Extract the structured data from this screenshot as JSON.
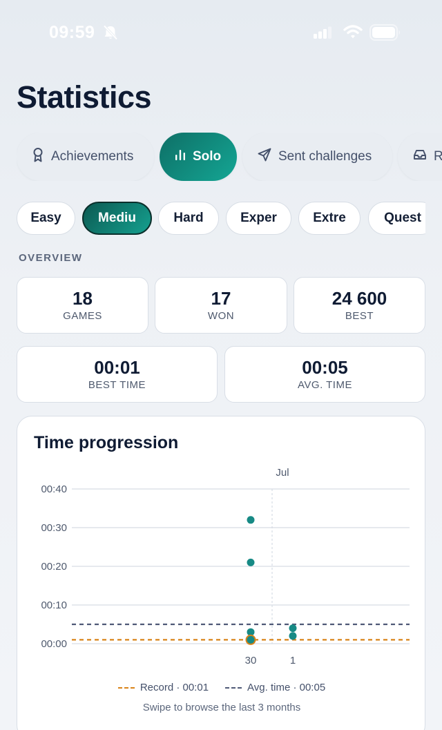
{
  "status_bar": {
    "time": "09:59",
    "icons": [
      "bell-off-icon",
      "signal-icon",
      "wifi-icon",
      "battery-icon"
    ]
  },
  "page": {
    "title": "Statistics"
  },
  "tabs": [
    {
      "label": "Achievements",
      "icon": "ribbon-icon",
      "active": false
    },
    {
      "label": "Solo",
      "icon": "bar-chart-icon",
      "active": true
    },
    {
      "label": "Sent challenges",
      "icon": "send-icon",
      "active": false
    },
    {
      "label": "Re",
      "icon": "inbox-icon",
      "active": false
    }
  ],
  "levels": [
    {
      "label": "Easy",
      "active": false
    },
    {
      "label": "Mediu",
      "active": true
    },
    {
      "label": "Hard",
      "active": false
    },
    {
      "label": "Exper",
      "active": false
    },
    {
      "label": "Extre",
      "active": false
    },
    {
      "label": "Quest",
      "active": false
    }
  ],
  "overview": {
    "label": "OVERVIEW",
    "games": {
      "value": "18",
      "label": "GAMES"
    },
    "won": {
      "value": "17",
      "label": "WON"
    },
    "best": {
      "value": "24 600",
      "label": "BEST"
    },
    "best_time": {
      "value": "00:01",
      "label": "BEST TIME"
    },
    "avg_time": {
      "value": "00:05",
      "label": "AVG. TIME"
    }
  },
  "chart": {
    "title": "Time progression",
    "legend": {
      "record": "Record · 00:01",
      "avg": "Avg. time · 00:05"
    },
    "hint": "Swipe to browse the last 3 months",
    "colors": {
      "points": "#178a85",
      "record": "#d98318",
      "avg": "#4e5876",
      "grid": "#d6dce4"
    }
  },
  "chart_data": {
    "type": "scatter",
    "title": "Time progression",
    "x_ticks": [
      "30",
      "1"
    ],
    "month_label": "Jul",
    "y_ticks": [
      "00:00",
      "00:10",
      "00:20",
      "00:30",
      "00:40"
    ],
    "ylim": [
      0,
      40
    ],
    "grid": true,
    "legend_placement": "bottom",
    "series": [
      {
        "x": "30",
        "y_seconds": [
          32,
          21,
          3,
          1
        ]
      },
      {
        "x": "1",
        "y_seconds": [
          4,
          2
        ]
      }
    ],
    "reference_lines": [
      {
        "name": "Record · 00:01",
        "y_seconds": 1
      },
      {
        "name": "Avg. time · 00:05",
        "y_seconds": 5
      }
    ]
  }
}
